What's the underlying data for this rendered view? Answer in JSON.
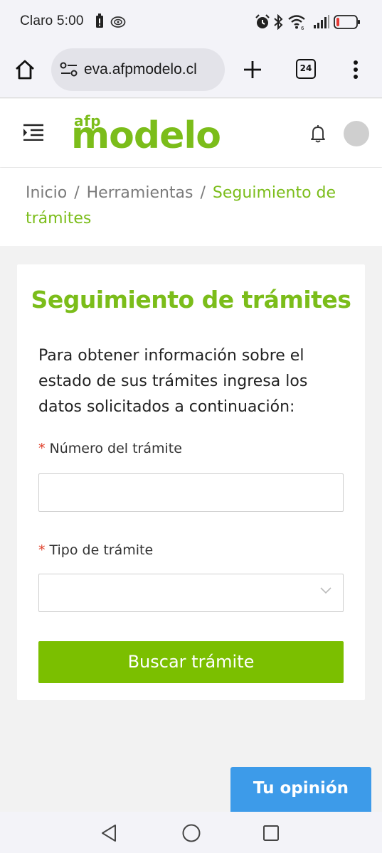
{
  "status_bar": {
    "carrier_time": "Claro 5:00",
    "icons": [
      "sim-alert-icon",
      "hotspot-icon",
      "alarm-icon",
      "bluetooth-icon",
      "wifi-icon",
      "signal-icon",
      "battery-icon"
    ],
    "battery_color": "#e53935"
  },
  "browser": {
    "url": "eva.afpmodelo.cl",
    "tab_count": "24",
    "icons": [
      "home-icon",
      "site-settings-icon",
      "new-tab-icon",
      "tabs-icon",
      "menu-icon"
    ]
  },
  "header": {
    "logo_small": "afp",
    "logo_big": "modelo",
    "brand_color": "#7bbd1a",
    "icons": [
      "menu-toggle-icon",
      "bell-icon",
      "avatar"
    ]
  },
  "breadcrumb": {
    "items": [
      "Inicio",
      "Herramientas"
    ],
    "current": "Seguimiento de trámites",
    "separator": "/"
  },
  "form": {
    "title": "Seguimiento de trámites",
    "intro": "Para obtener información sobre el estado de sus trámites ingresa los datos solicitados a continuación:",
    "required_mark": "*",
    "numero_label": "Número del trámite",
    "numero_value": "",
    "tipo_label": "Tipo de trámite",
    "tipo_value": "",
    "submit_label": "Buscar trámite",
    "button_color": "#7bbf00"
  },
  "feedback": {
    "label": "Tu opinión",
    "color": "#3d9be9"
  },
  "navbar": {
    "icons": [
      "back-icon",
      "home-circle-icon",
      "recents-icon"
    ]
  }
}
